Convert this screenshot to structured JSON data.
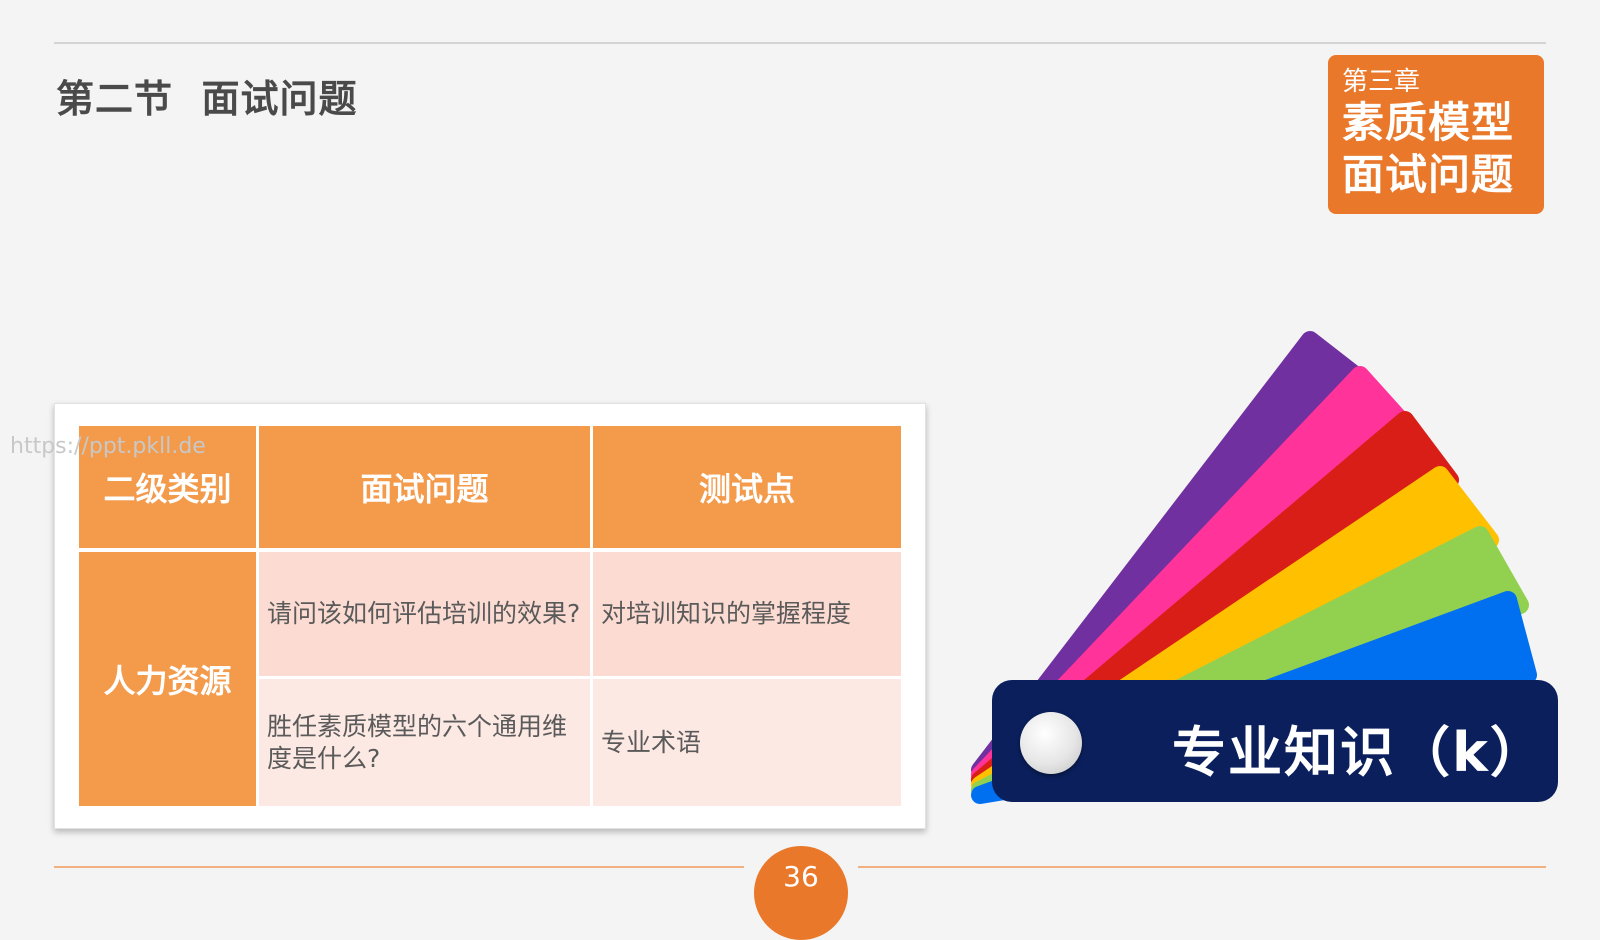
{
  "header": {
    "section_title": "第二节  面试问题"
  },
  "chapter_badge": {
    "label": "第三章",
    "line1": "素质模型",
    "line2": "面试问题",
    "color": "#e9782a"
  },
  "watermark": "https://ppt.pkll.de",
  "table": {
    "headers": [
      "二级类别",
      "面试问题",
      "测试点"
    ],
    "category": "人力资源",
    "rows": [
      {
        "question": "请问该如何评估培训的效果?",
        "test_point": "对培训知识的掌握程度"
      },
      {
        "question": "胜任素质模型的六个通用维度是什么?",
        "test_point": "专业术语"
      }
    ],
    "header_color": "#f39a4b"
  },
  "fan_graphic": {
    "label": "专业知识（k）",
    "blade_colors": [
      "#7030a0",
      "#ff3399",
      "#d91e18",
      "#ffc000",
      "#92d050",
      "#0070f0"
    ],
    "label_background": "#0b1f5c"
  },
  "footer": {
    "page_number": "36"
  }
}
